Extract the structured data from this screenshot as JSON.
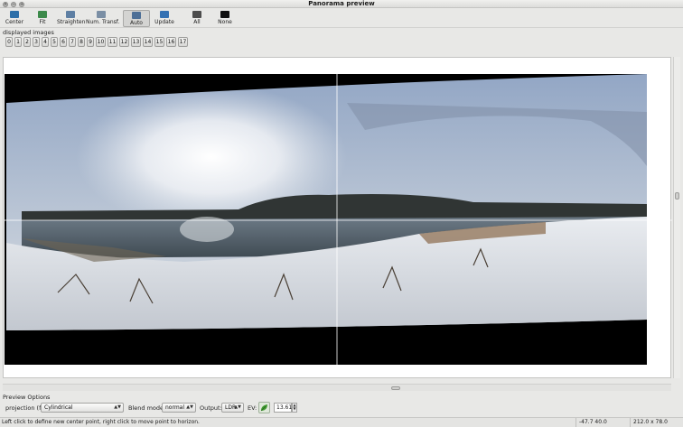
{
  "window": {
    "title": "Panorama preview",
    "buttons": [
      "×",
      "−",
      "+"
    ]
  },
  "toolbar": {
    "buttons": [
      {
        "label": "Center",
        "icon": "center-icon"
      },
      {
        "label": "Fit",
        "icon": "fit-icon"
      },
      {
        "label": "Straighten",
        "icon": "straighten-icon"
      },
      {
        "label": "Num. Transf.",
        "icon": "numeric-transform-icon"
      },
      {
        "label": "Auto",
        "icon": "auto-icon",
        "active": true
      },
      {
        "label": "Update",
        "icon": "update-icon"
      },
      {
        "label": "All",
        "icon": "all-images-icon"
      },
      {
        "label": "None",
        "icon": "no-images-icon"
      }
    ]
  },
  "displayed_images": {
    "label": "displayed images",
    "buttons": [
      "0",
      "1",
      "2",
      "3",
      "4",
      "5",
      "6",
      "7",
      "8",
      "9",
      "10",
      "11",
      "12",
      "13",
      "14",
      "15",
      "16",
      "17"
    ]
  },
  "preview_options": {
    "label": "Preview Options",
    "projection_label": "projection (f):",
    "projection_value": "Cylindrical",
    "blend_label": "Blend mode:",
    "blend_value": "normal",
    "output_label": "Output:",
    "output_value": "LDR",
    "ev_label": "EV:",
    "ev_value": "13.61"
  },
  "status": {
    "message": "Left click to define new center point, right click to move point to horizon.",
    "coords": "-47.7 40.0",
    "fov": "212.0 x 78.0"
  },
  "colors": {
    "accent_green": "#3f9b2f",
    "background": "#e8e8e6"
  }
}
